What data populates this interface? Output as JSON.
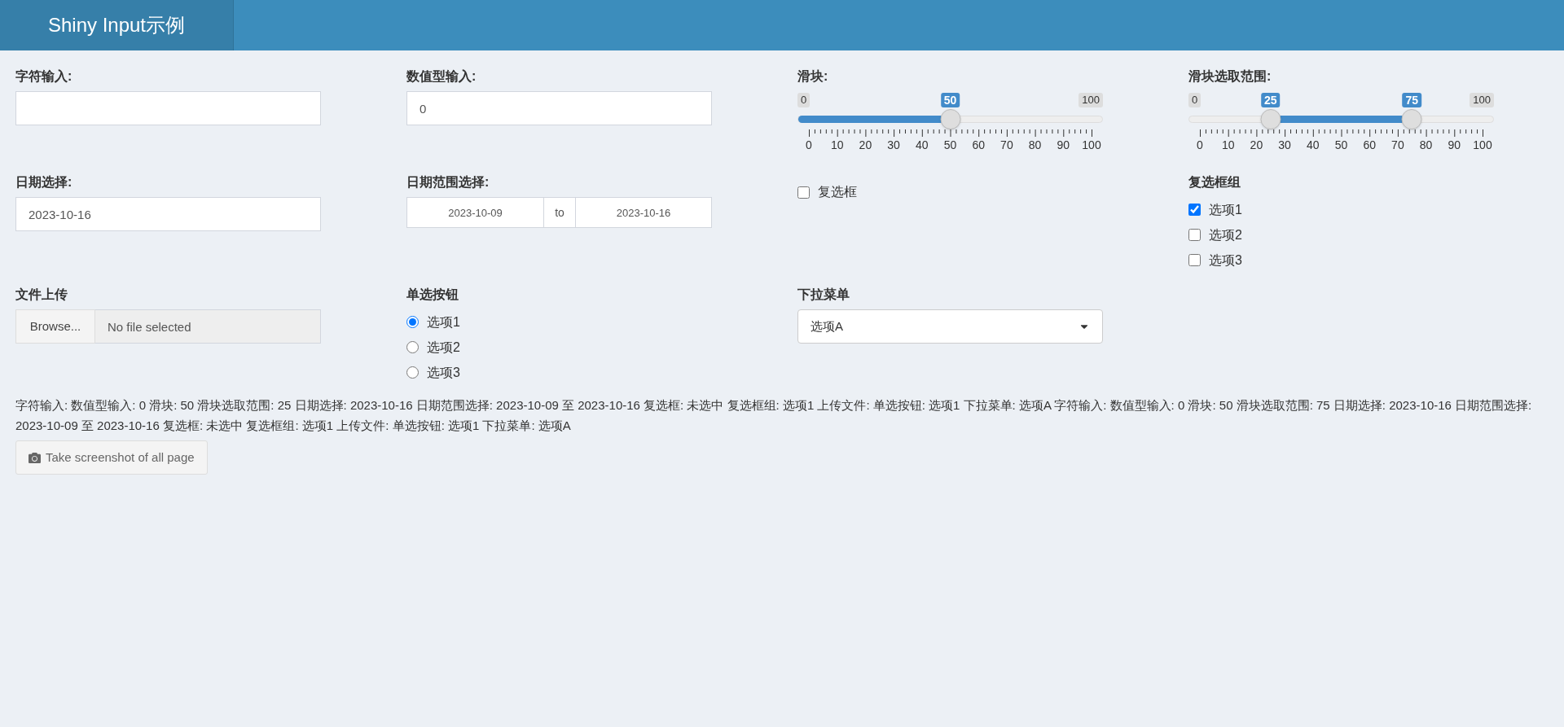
{
  "header": {
    "title": "Shiny Input示例"
  },
  "text_input": {
    "label": "字符输入:"
  },
  "numeric_input": {
    "label": "数值型输入:",
    "value": "0"
  },
  "slider": {
    "label": "滑块:",
    "min_label": "0",
    "max_label": "100",
    "handles": [
      {
        "value_label": "50",
        "level": 0.5
      }
    ],
    "ticks": [
      "0",
      "10",
      "20",
      "30",
      "40",
      "50",
      "60",
      "70",
      "80",
      "90",
      "100"
    ]
  },
  "range_slider": {
    "label": "滑块选取范围:",
    "min_label": "0",
    "max_label": "100",
    "handles": [
      {
        "value_label": "25",
        "level": 0.25
      },
      {
        "value_label": "75",
        "level": 0.75
      }
    ],
    "ticks": [
      "0",
      "10",
      "20",
      "30",
      "40",
      "50",
      "60",
      "70",
      "80",
      "90",
      "100"
    ]
  },
  "date_input": {
    "label": "日期选择:",
    "value": "2023-10-16"
  },
  "date_range": {
    "label": "日期范围选择:",
    "start": "2023-10-09",
    "separator": "to",
    "end": "2023-10-16"
  },
  "checkbox": {
    "label": "复选框",
    "checked": false
  },
  "checkbox_group": {
    "label": "复选框组",
    "options": [
      {
        "label": "选项1",
        "checked": true
      },
      {
        "label": "选项2",
        "checked": false
      },
      {
        "label": "选项3",
        "checked": false
      }
    ]
  },
  "file_input": {
    "label": "文件上传",
    "button": "Browse...",
    "placeholder": "No file selected"
  },
  "radio_buttons": {
    "label": "单选按钮",
    "options": [
      {
        "label": "选项1",
        "selected": true
      },
      {
        "label": "选项2",
        "selected": false
      },
      {
        "label": "选项3",
        "selected": false
      }
    ]
  },
  "select": {
    "label": "下拉菜单",
    "value": "选项A"
  },
  "output_text": "字符输入: 数值型输入: 0 滑块: 50 滑块选取范围: 25 日期选择: 2023-10-16 日期范围选择: 2023-10-09 至 2023-10-16 复选框: 未选中 复选框组: 选项1 上传文件: 单选按钮: 选项1 下拉菜单: 选项A 字符输入: 数值型输入: 0 滑块: 50 滑块选取范围: 75 日期选择: 2023-10-16 日期范围选择: 2023-10-09 至 2023-10-16 复选框: 未选中 复选框组: 选项1 上传文件: 单选按钮: 选项1 下拉菜单: 选项A",
  "screenshot_button": {
    "label": "Take screenshot of all page"
  }
}
